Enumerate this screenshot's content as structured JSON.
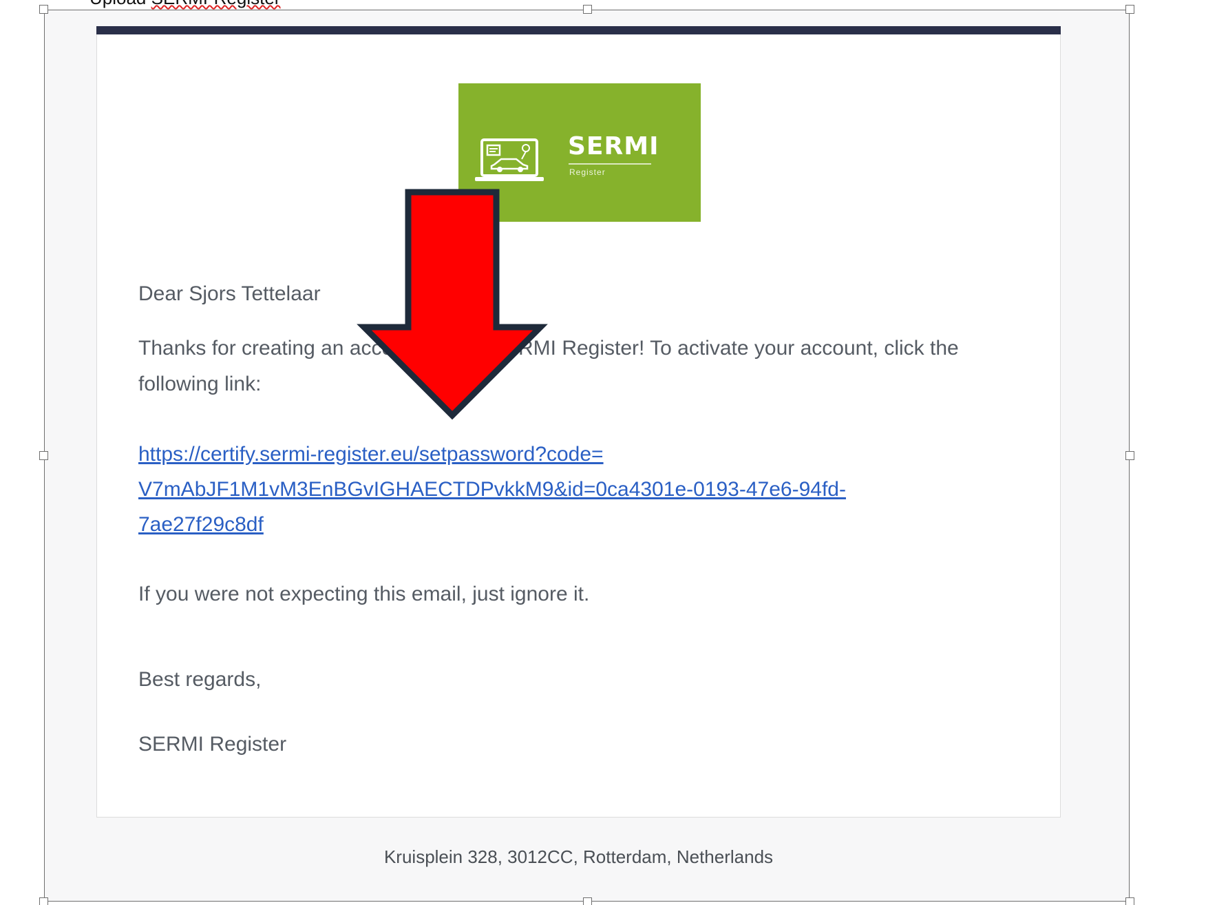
{
  "document": {
    "top_cutoff_text": "Upload",
    "top_cutoff_squiggle": "SERMI-Register"
  },
  "email": {
    "header_bar_color": "#2a2f49",
    "logo": {
      "wordmark": "SERMI",
      "subtitle": "Register",
      "background": "#86b22c",
      "icon": "laptop-car-diagnostics-icon"
    },
    "greeting": "Dear Sjors Tettelaar",
    "thanks_line1": "Thanks for creating an account on the SERMI Register! To activate your account, click the",
    "thanks_line2": "following link:",
    "activation_link": {
      "line1": "https://certify.sermi-register.eu/setpassword?code=",
      "line2": "V7mAbJF1M1vM3EnBGvIGHAECTDPvkkM9&id=0ca4301e-0193-47e6-94fd-",
      "line3": "7ae27f29c8df",
      "color": "#2a5fc4"
    },
    "ignore_text": "If you were not expecting this email, just ignore it.",
    "closing": "Best regards,",
    "signature": "SERMI Register",
    "footer_address": "Kruisplein 328, 3012CC, Rotterdam, Netherlands"
  },
  "annotation": {
    "icon": "red-down-arrow-icon",
    "fill": "#ff0000",
    "outline": "#1e2a3a"
  }
}
